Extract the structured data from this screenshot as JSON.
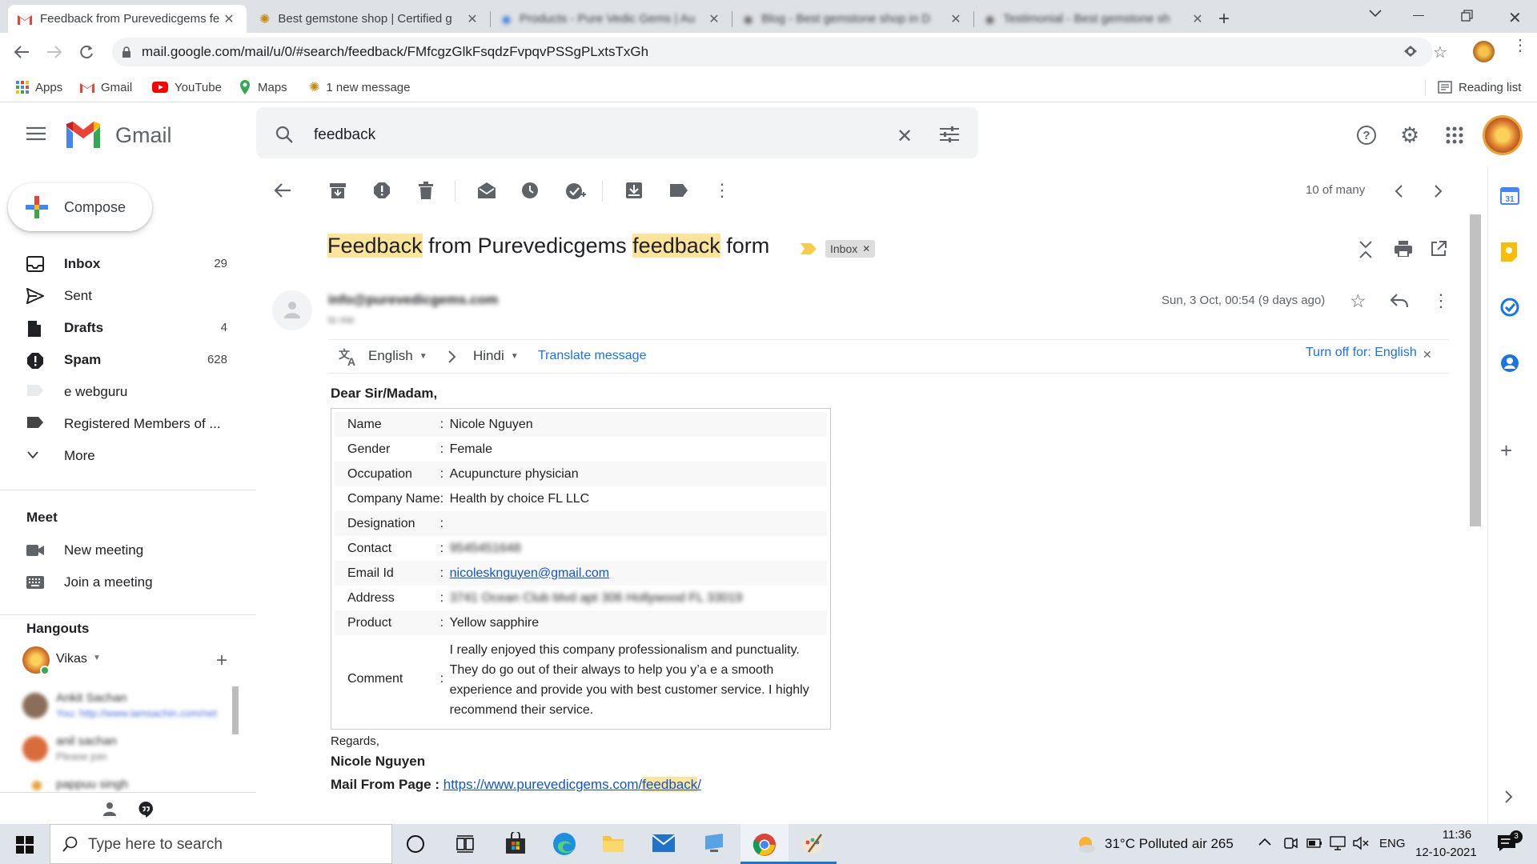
{
  "browser": {
    "tabs": [
      {
        "title": "Feedback from Purevedicgems fe",
        "active": true
      },
      {
        "title": "Best gemstone shop | Certified g",
        "active": false
      },
      {
        "title": "Products - Pure Vedic Gems | Au",
        "active": false
      },
      {
        "title": "Blog - Best gemstone shop in D",
        "active": false
      },
      {
        "title": "Testimonial - Best gemstone sh",
        "active": false
      }
    ],
    "new_tab": "+",
    "url": "mail.google.com/mail/u/0/#search/feedback/FMfcgzGlkFsqdzFvpqvPSSgPLxtsTxGh",
    "bookmarks": [
      "Apps",
      "Gmail",
      "YouTube",
      "Maps",
      "1 new message"
    ],
    "reading_list": "Reading list"
  },
  "gmail": {
    "logo_text": "Gmail",
    "search_value": "feedback",
    "compose_label": "Compose",
    "nav": [
      {
        "label": "Inbox",
        "count": "29",
        "bold": true
      },
      {
        "label": "Sent",
        "count": "",
        "bold": false
      },
      {
        "label": "Drafts",
        "count": "4",
        "bold": true
      },
      {
        "label": "Spam",
        "count": "628",
        "bold": true
      },
      {
        "label": "e webguru",
        "count": "",
        "bold": false
      },
      {
        "label": "Registered Members of ...",
        "count": "",
        "bold": false
      },
      {
        "label": "More",
        "count": "",
        "bold": false
      }
    ],
    "meet": {
      "title": "Meet",
      "new_meeting": "New meeting",
      "join_meeting": "Join a meeting"
    },
    "hangouts": {
      "title": "Hangouts",
      "user": "Vikas",
      "contacts": [
        {
          "name": "Ankit Sachan",
          "preview": "You: http://www.iamsachin.com/net"
        },
        {
          "name": "anil sachan",
          "preview": "Please join"
        },
        {
          "name": "pappuu singh",
          "preview": ""
        }
      ]
    },
    "pager": "10 of many",
    "email": {
      "subject_parts": [
        "Feedback",
        " from Purevedicgems ",
        "feedback",
        " form"
      ],
      "label_chip": "Inbox",
      "sender": "info@purevedicgems.com",
      "to_line": "to me",
      "date": "Sun, 3 Oct, 00:54 (9 days ago)",
      "translate": {
        "from_lang": "English",
        "to_lang": "Hindi",
        "action": "Translate message",
        "turn_off": "Turn off for: English"
      },
      "greeting": "Dear Sir/Madam,",
      "fields": [
        {
          "label": "Name",
          "value": "Nicole Nguyen"
        },
        {
          "label": "Gender",
          "value": "Female"
        },
        {
          "label": "Occupation",
          "value": "Acupuncture physician"
        },
        {
          "label": "Company Name",
          "value": "Health by choice FL LLC"
        },
        {
          "label": "Designation",
          "value": ""
        },
        {
          "label": "Contact",
          "value": "9545451648"
        },
        {
          "label": "Email Id",
          "value": "nicolesknguyen@gmail.com"
        },
        {
          "label": "Address",
          "value": "3741 Ocean Club blvd apt 306 Hollywood FL 33019"
        },
        {
          "label": "Product",
          "value": "Yellow sapphire"
        }
      ],
      "comment_label": "Comment",
      "comment": "I really enjoyed this company professionalism and punctuality. They do go out of their always to help you y’a e a smooth experience and provide you with best customer service. I highly recommend their service.",
      "regards": "Regards,",
      "signature": "Nicole Nguyen",
      "mail_from_label": "Mail From Page : ",
      "mail_from_url_prefix": "https://www.purevedicgems.com/",
      "mail_from_url_highlight": "feedback",
      "mail_from_url_suffix": "/"
    }
  },
  "taskbar": {
    "search_placeholder": "Type here to search",
    "weather": "31°C  Polluted air 265",
    "lang": "ENG",
    "time": "11:36",
    "date": "12-10-2021"
  },
  "colors": {
    "accent_blue": "#1a73e8",
    "highlight": "#fce49a",
    "gmail_red": "#ea4335",
    "compose_plus": "#ea4335"
  }
}
